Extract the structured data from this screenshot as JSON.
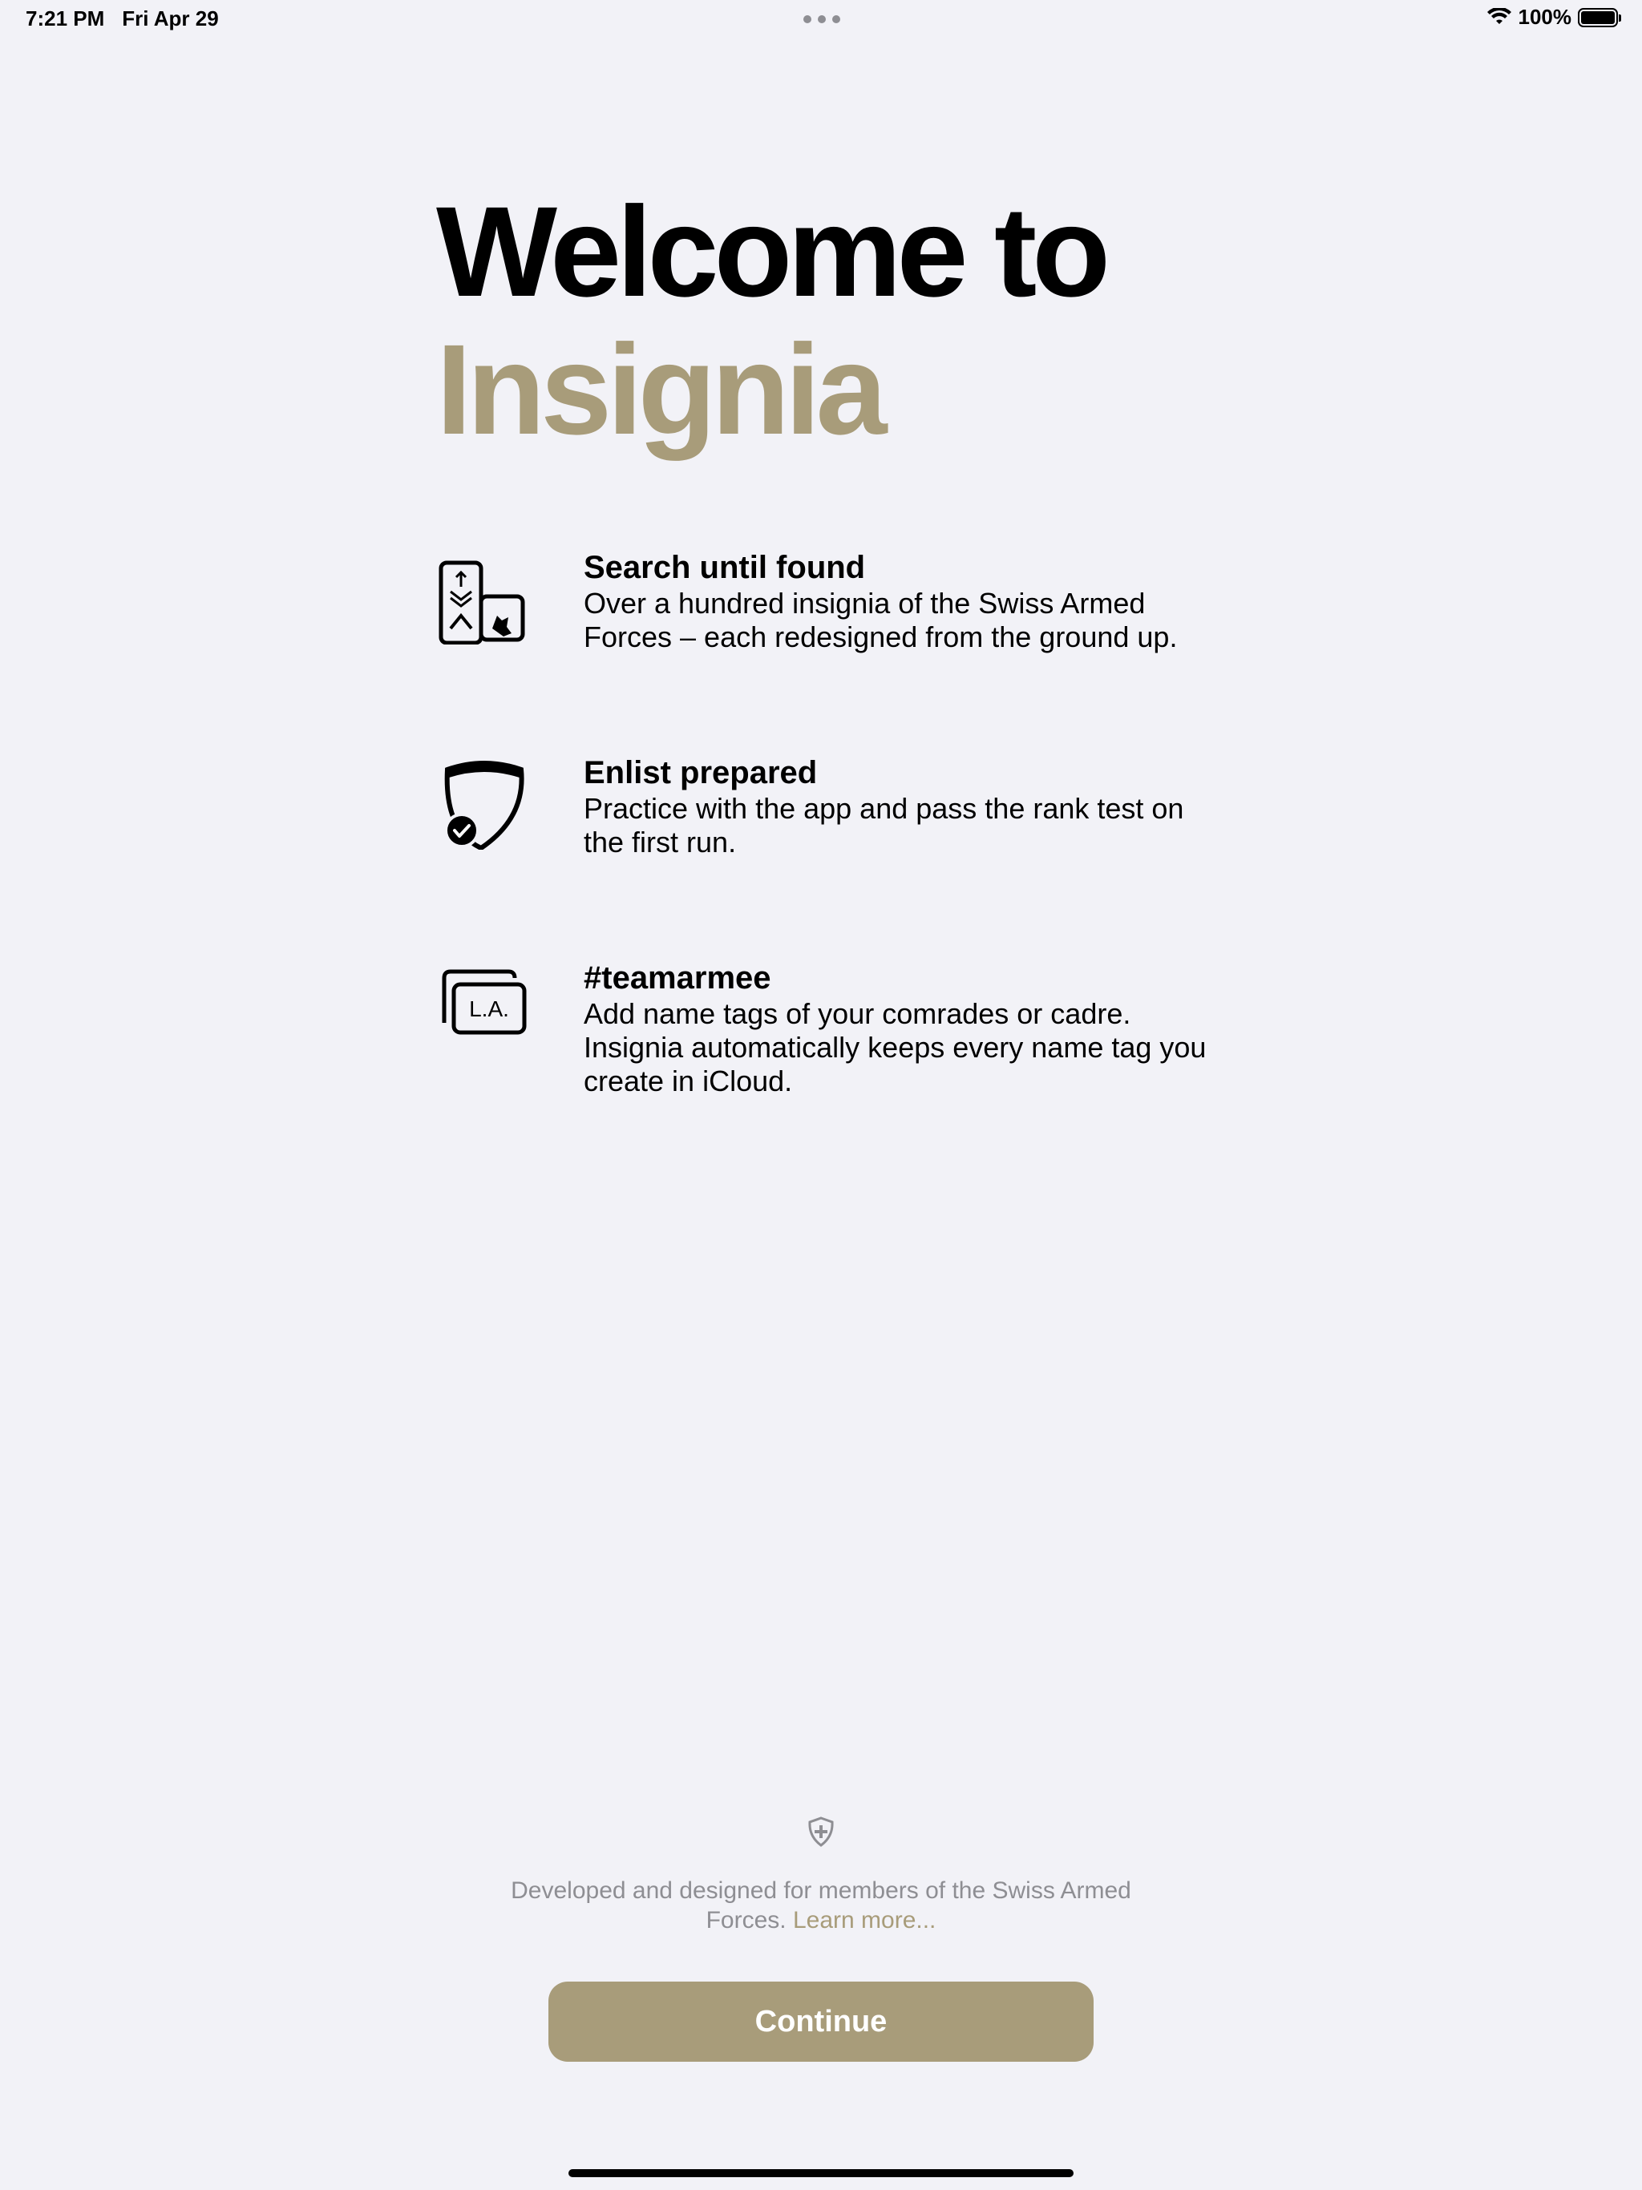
{
  "status_bar": {
    "time": "7:21 PM",
    "date": "Fri Apr 29",
    "battery_percent": "100%",
    "battery_level": 1.0
  },
  "title": {
    "line1": "Welcome to",
    "line2": "Insignia"
  },
  "features": [
    {
      "icon": "insignia-cards-icon",
      "title": "Search until found",
      "description": "Over a hundred insignia of the Swiss Armed Forces – each redesigned from the ground up."
    },
    {
      "icon": "shield-checkmark-icon",
      "title": "Enlist prepared",
      "description": "Practice with the app and pass the rank test on the first run."
    },
    {
      "icon": "name-tags-icon",
      "icon_label": "L.A.",
      "title": "#teamarmee",
      "description": "Add name tags of your comrades or cadre. Insignia automatically keeps every name tag you create in iCloud."
    }
  ],
  "footer": {
    "icon": "swiss-shield-icon",
    "text": "Developed and designed for members of the Swiss Armed Forces.",
    "link": "Learn more..."
  },
  "continue_button": {
    "label": "Continue"
  },
  "colors": {
    "background": "#f2f2f7",
    "accent": "#a89c7a",
    "secondary_text": "#8e8e93",
    "primary_text": "#000000"
  }
}
